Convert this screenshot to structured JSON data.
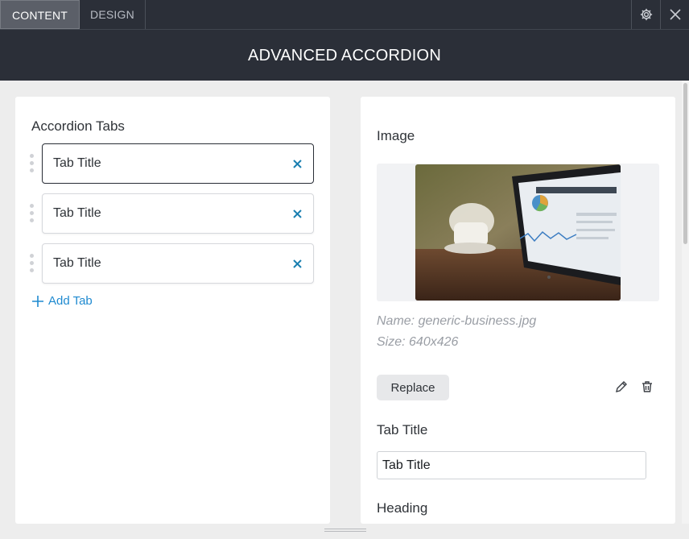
{
  "tabs": [
    {
      "label": "CONTENT",
      "active": true
    },
    {
      "label": "DESIGN",
      "active": false
    }
  ],
  "header": {
    "title": "ADVANCED ACCORDION"
  },
  "left_panel": {
    "title": "Accordion Tabs",
    "items": [
      {
        "label": "Tab Title",
        "active": true
      },
      {
        "label": "Tab Title",
        "active": false
      },
      {
        "label": "Tab Title",
        "active": false
      }
    ],
    "add_label": "Add Tab"
  },
  "right_panel": {
    "image_title": "Image",
    "image_name": "Name: generic-business.jpg",
    "image_size": "Size: 640x426",
    "replace_label": "Replace",
    "tab_title_label": "Tab Title",
    "tab_title_value": "Tab Title",
    "heading_label": "Heading"
  },
  "icons": {
    "settings": "gear-icon",
    "close": "close-icon",
    "remove": "x-icon",
    "drag": "drag-handle-icon",
    "add": "plus-icon",
    "edit": "pencil-icon",
    "delete": "trash-icon"
  },
  "colors": {
    "header_bg": "#2b2f38",
    "accent": "#1f8ad0",
    "remove_icon": "#1a7fb0"
  }
}
